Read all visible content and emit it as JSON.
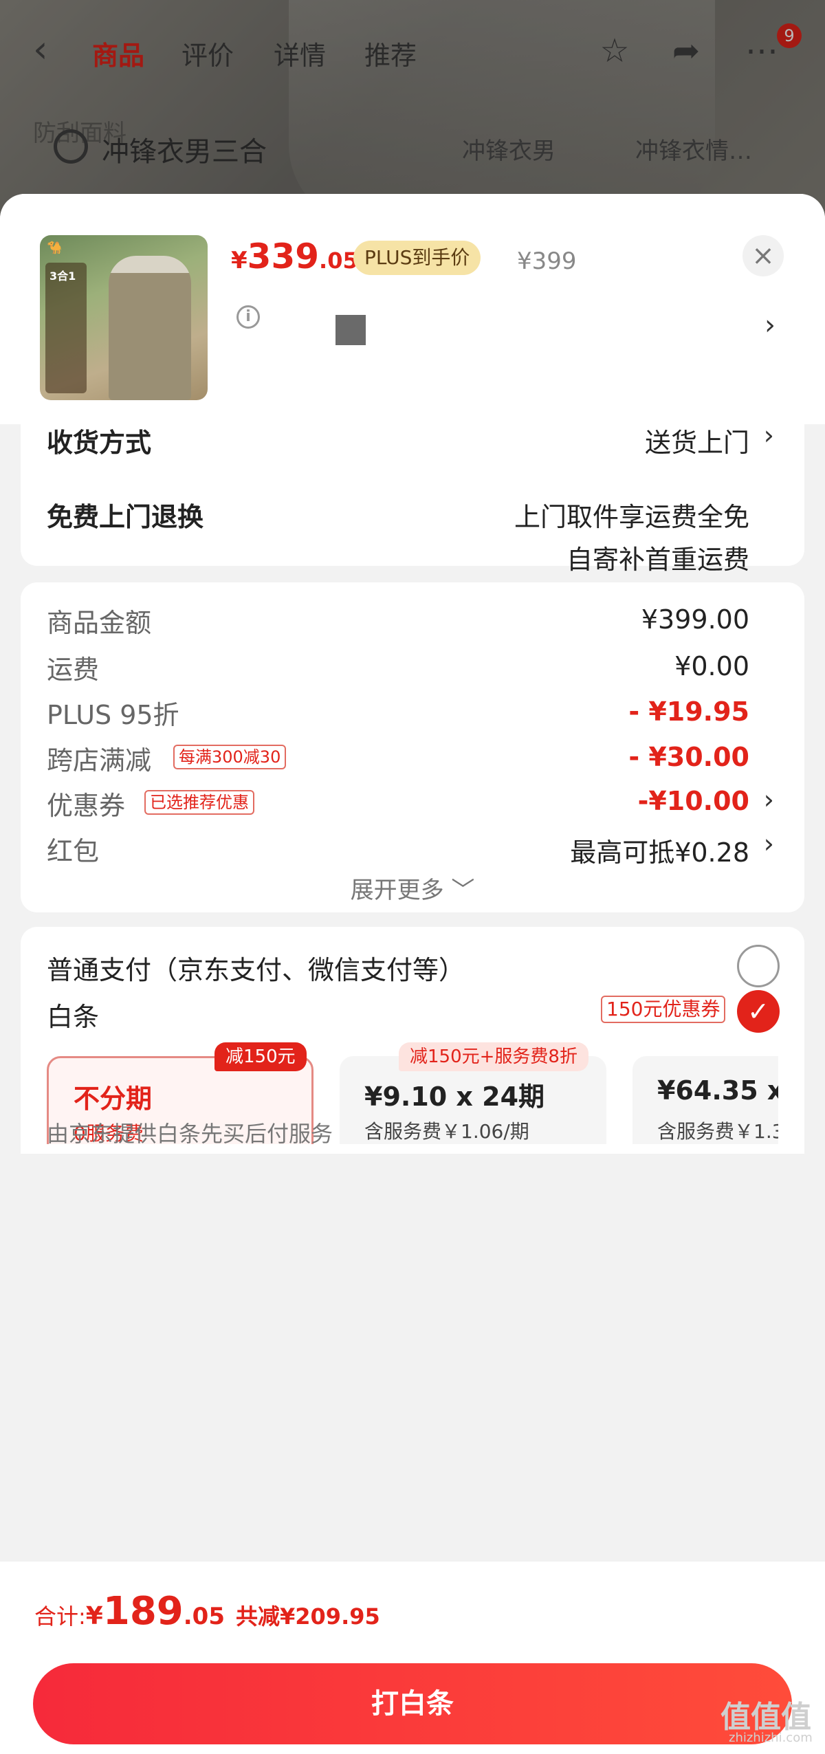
{
  "nav": {
    "tabs": [
      "商品",
      "评价",
      "详情",
      "推荐"
    ],
    "cart_badge": "9",
    "faded_tag": "防刮面料"
  },
  "search": {
    "query": "冲锋衣男三合",
    "chips": [
      "冲锋衣男",
      "冲锋衣情…"
    ]
  },
  "product": {
    "thumb_badge": "3合1",
    "price_symbol": "¥",
    "price_int": "339",
    "price_dec": ".05",
    "plus_label": "PLUS到手价",
    "original_price": "¥399"
  },
  "delivery": {
    "method_label": "收货方式",
    "method_value": "送货上门",
    "return_label": "免费上门退换",
    "return_line1": "上门取件享运费全免",
    "return_line2": "自寄补首重运费"
  },
  "summary": {
    "items": [
      {
        "label": "商品金额",
        "value": "¥399.00"
      },
      {
        "label": "运费",
        "value": "¥0.00"
      },
      {
        "label": "PLUS 95折",
        "value": "- ¥19.95"
      },
      {
        "label": "跨店满减",
        "tag": "每满300减30",
        "value": "- ¥30.00"
      },
      {
        "label": "优惠券",
        "tag": "已选推荐优惠",
        "value": "-¥10.00"
      },
      {
        "label": "红包",
        "value": "最高可抵¥0.28"
      }
    ],
    "expand_label": "展开更多"
  },
  "payment": {
    "normal_label": "普通支付（京东支付、微信支付等）",
    "baitiao_label": "白条",
    "baitiao_coupon": "150元优惠券",
    "plans": [
      {
        "main": "不分期",
        "sub": "0服务费",
        "badge": "减150元"
      },
      {
        "main": "¥9.10 x 24期",
        "sub": "含服务费￥1.06/期",
        "badge": "减150元+服务费8折"
      },
      {
        "main": "¥64.35 x",
        "sub": "含服务费￥1.3"
      }
    ],
    "provider_note": "由京东提供白条先买后付服务"
  },
  "footer": {
    "total_label": "合计:",
    "total_sym": "¥",
    "total_int": "189",
    "total_dec": ".05",
    "saved": "共减¥209.95",
    "pay_button": "打白条",
    "watermark": "值值值",
    "watermark_sub": "zhizhizhi.com"
  },
  "colors": {
    "accent": "#e2231a",
    "plus_gold": "#f6e3a6"
  }
}
